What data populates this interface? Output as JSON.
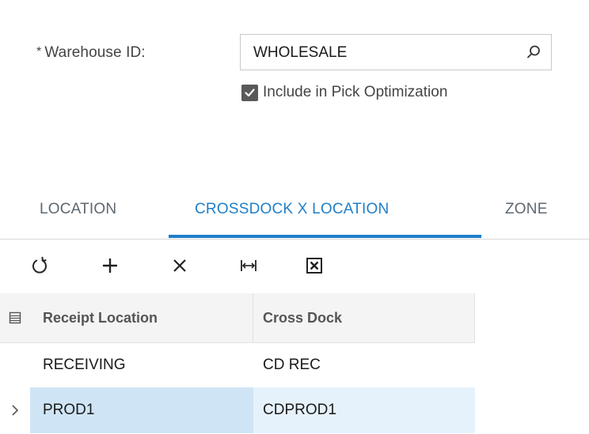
{
  "form": {
    "required_mark": "*",
    "warehouse_label": "Warehouse ID:",
    "warehouse_value": "WHOLESALE",
    "include_pick_optimization_label": "Include in Pick Optimization",
    "include_pick_optimization_checked": true
  },
  "tabs": [
    {
      "label": "LOCATION",
      "active": false
    },
    {
      "label": "CROSSDOCK X LOCATION",
      "active": true
    },
    {
      "label": "ZONE",
      "active": false
    }
  ],
  "toolbar": {
    "icons": [
      "refresh-icon",
      "add-icon",
      "delete-icon",
      "fit-to-screen-icon",
      "export-excel-icon"
    ]
  },
  "grid": {
    "columns": [
      "Receipt Location",
      "Cross Dock"
    ],
    "rows": [
      {
        "receipt_location": "RECEIVING",
        "cross_dock": "CD REC",
        "selected": false
      },
      {
        "receipt_location": "PROD1",
        "cross_dock": "CDPROD1",
        "selected": true
      }
    ]
  },
  "colors": {
    "accent": "#1f7fc9",
    "selected_row_primary": "#cfe5f5",
    "selected_row_secondary": "#e6f2fb",
    "checkbox": "#595959"
  }
}
